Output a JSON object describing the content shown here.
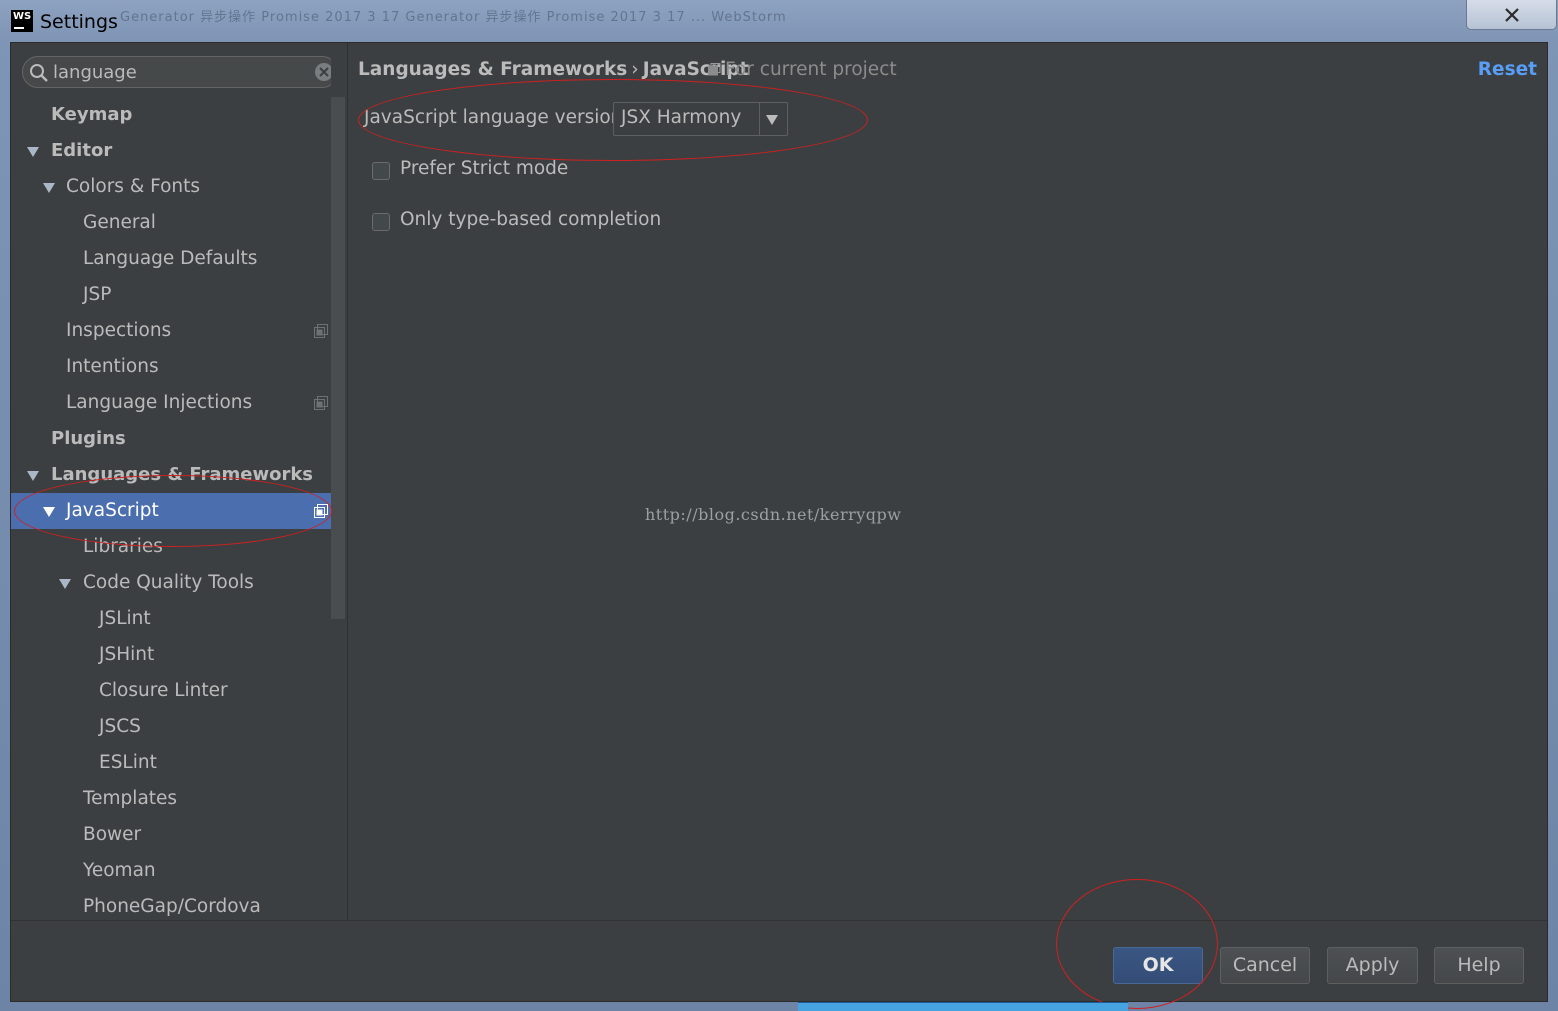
{
  "window": {
    "title": "Settings",
    "app_icon_text": "WS",
    "background_title_text": "Generator 异步操作 Promise 2017 3 17 Generator 异步操作 Promise 2017 3 17 ... WebStorm"
  },
  "search": {
    "value": "language",
    "placeholder": ""
  },
  "tree": [
    {
      "label": "Keymap",
      "bold": true,
      "level": 0,
      "arrow": false
    },
    {
      "label": "Editor",
      "bold": true,
      "level": 0,
      "arrow": true
    },
    {
      "label": "Colors & Fonts",
      "bold": false,
      "level": 1,
      "arrow": true
    },
    {
      "label": "General",
      "bold": false,
      "level": 2,
      "arrow": false
    },
    {
      "label": "Language Defaults",
      "bold": false,
      "level": 2,
      "arrow": false
    },
    {
      "label": "JSP",
      "bold": false,
      "level": 2,
      "arrow": false
    },
    {
      "label": "Inspections",
      "bold": false,
      "level": 1,
      "arrow": false,
      "project_icon": true
    },
    {
      "label": "Intentions",
      "bold": false,
      "level": 1,
      "arrow": false
    },
    {
      "label": "Language Injections",
      "bold": false,
      "level": 1,
      "arrow": false,
      "project_icon": true
    },
    {
      "label": "Plugins",
      "bold": true,
      "level": 0,
      "arrow": false
    },
    {
      "label": "Languages & Frameworks",
      "bold": true,
      "level": 0,
      "arrow": true
    },
    {
      "label": "JavaScript",
      "bold": false,
      "level": 1,
      "arrow": true,
      "selected": true,
      "project_icon": true
    },
    {
      "label": "Libraries",
      "bold": false,
      "level": 2,
      "arrow": false
    },
    {
      "label": "Code Quality Tools",
      "bold": false,
      "level": 2,
      "arrow": true
    },
    {
      "label": "JSLint",
      "bold": false,
      "level": 3,
      "arrow": false
    },
    {
      "label": "JSHint",
      "bold": false,
      "level": 3,
      "arrow": false
    },
    {
      "label": "Closure Linter",
      "bold": false,
      "level": 3,
      "arrow": false
    },
    {
      "label": "JSCS",
      "bold": false,
      "level": 3,
      "arrow": false
    },
    {
      "label": "ESLint",
      "bold": false,
      "level": 3,
      "arrow": false
    },
    {
      "label": "Templates",
      "bold": false,
      "level": 2,
      "arrow": false
    },
    {
      "label": "Bower",
      "bold": false,
      "level": 2,
      "arrow": false
    },
    {
      "label": "Yeoman",
      "bold": false,
      "level": 2,
      "arrow": false
    },
    {
      "label": "PhoneGap/Cordova",
      "bold": false,
      "level": 2,
      "arrow": false
    }
  ],
  "main": {
    "breadcrumb_parent": "Languages & Frameworks",
    "breadcrumb_sep": "›",
    "breadcrumb_current": "JavaScript",
    "scope_note": "For current project",
    "reset_label": "Reset",
    "js_version_label": "JavaScript language version",
    "js_version_value": "JSX Harmony",
    "prefer_strict_label": "Prefer Strict mode",
    "prefer_strict_checked": false,
    "type_completion_label": "Only type-based completion",
    "type_completion_checked": false,
    "watermark": "http://blog.csdn.net/kerryqpw"
  },
  "footer": {
    "ok_label": "OK",
    "cancel_label": "Cancel",
    "apply_label": "Apply",
    "help_label": "Help"
  },
  "colors": {
    "background": "#3c3f41",
    "selection": "#4b6eaf",
    "text": "#bbbbbb",
    "link": "#589df6",
    "annotation": "#d02020"
  }
}
